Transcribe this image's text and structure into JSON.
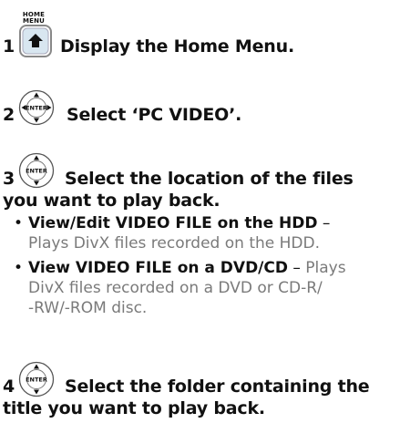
{
  "home_button": {
    "label_line1": "HOME",
    "label_line2": "MENU"
  },
  "enter_label": "ENTER",
  "steps": [
    {
      "number": "1",
      "text": "Display the Home Menu."
    },
    {
      "number": "2",
      "text": "Select ‘PC VIDEO’."
    },
    {
      "number": "3",
      "text_line1": "Select the location of the files",
      "text_line2": "you want to play back."
    },
    {
      "number": "4",
      "text_line1": "Select the folder containing the",
      "text_line2": "title you want to play back."
    }
  ],
  "options": [
    {
      "title": "View/Edit VIDEO FILE on the HDD",
      "separator": " –",
      "line2": "Plays DivX files recorded on the HDD."
    },
    {
      "title": "View VIDEO FILE on a DVD/CD",
      "separator": " –",
      "rest1": " Plays",
      "line2": "DivX files recorded on a DVD or CD-R/",
      "line3": "-RW/-ROM disc."
    }
  ],
  "bullet_char": "•"
}
